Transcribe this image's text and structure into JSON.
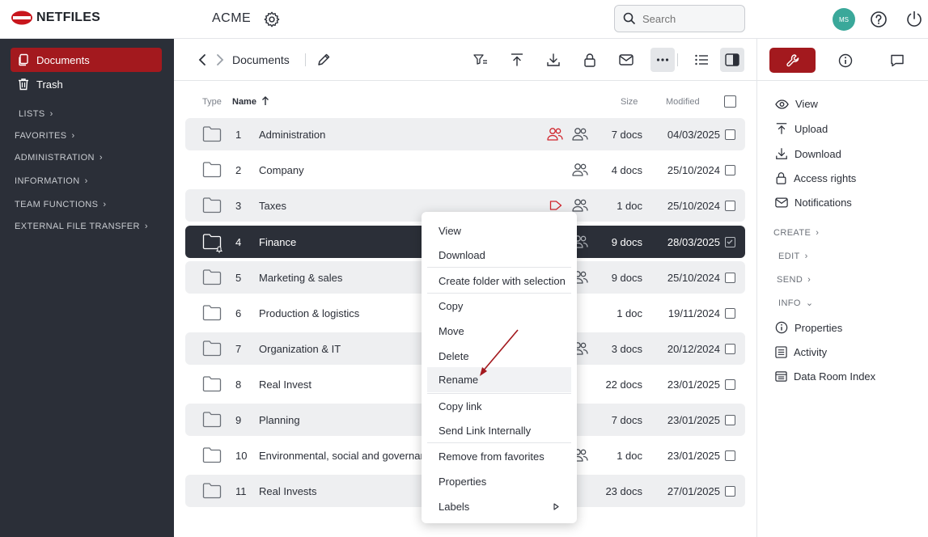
{
  "brand": {
    "logo_text": "NETFILES",
    "accent": "#a3191e",
    "dark": "#2b2f38"
  },
  "header": {
    "company": "ACME",
    "search_placeholder": "Search",
    "avatar_initials": "MS"
  },
  "sidebar": {
    "items": [
      {
        "label": "Documents",
        "icon": "documents-icon",
        "active": true
      },
      {
        "label": "Trash",
        "icon": "trash-icon",
        "active": false
      }
    ],
    "sections": [
      "LISTS",
      "FAVORITES",
      "ADMINISTRATION",
      "INFORMATION",
      "TEAM FUNCTIONS",
      "EXTERNAL FILE TRANSFER"
    ]
  },
  "toolbar": {
    "breadcrumb": "Documents"
  },
  "table": {
    "headers": {
      "type": "Type",
      "name": "Name",
      "size": "Size",
      "modified": "Modified"
    },
    "rows": [
      {
        "num": "1",
        "name": "Administration",
        "size": "7 docs",
        "date": "04/03/2025"
      },
      {
        "num": "2",
        "name": "Company",
        "size": "4 docs",
        "date": "25/10/2024"
      },
      {
        "num": "3",
        "name": "Taxes",
        "size": "1 doc",
        "date": "25/10/2024"
      },
      {
        "num": "4",
        "name": "Finance",
        "size": "9 docs",
        "date": "28/03/2025"
      },
      {
        "num": "5",
        "name": "Marketing & sales",
        "size": "9 docs",
        "date": "25/10/2024"
      },
      {
        "num": "6",
        "name": "Production & logistics",
        "size": "1 doc",
        "date": "19/11/2024"
      },
      {
        "num": "7",
        "name": "Organization & IT",
        "size": "3 docs",
        "date": "20/12/2024"
      },
      {
        "num": "8",
        "name": "Real Invest",
        "size": "22 docs",
        "date": "23/01/2025"
      },
      {
        "num": "9",
        "name": "Planning",
        "size": "7 docs",
        "date": "23/01/2025"
      },
      {
        "num": "10",
        "name": "Environmental, social and governance",
        "size": "1 doc",
        "date": "23/01/2025"
      },
      {
        "num": "11",
        "name": "Real Invests",
        "size": "23 docs",
        "date": "27/01/2025"
      }
    ]
  },
  "context_menu": {
    "items": [
      "View",
      "Download",
      "Create folder with selection",
      "Copy",
      "Move",
      "Delete",
      "Rename",
      "Copy link",
      "Send Link Internally",
      "Remove from favorites",
      "Properties",
      "Labels"
    ]
  },
  "right_panel": {
    "actions": [
      "View",
      "Upload",
      "Download",
      "Access rights",
      "Notifications"
    ],
    "sections": [
      "CREATE",
      "EDIT",
      "SEND",
      "INFO"
    ],
    "info_items": [
      "Properties",
      "Activity",
      "Data Room Index"
    ]
  }
}
